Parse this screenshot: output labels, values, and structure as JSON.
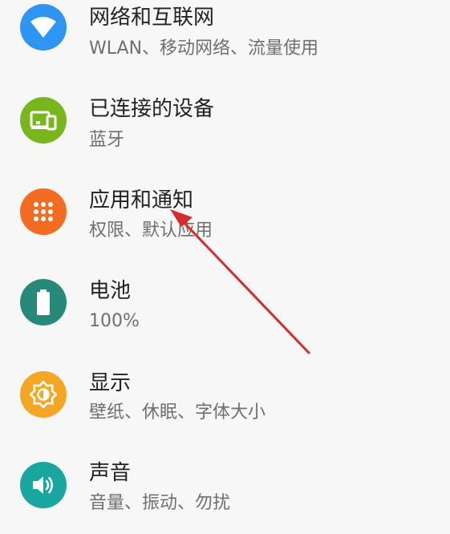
{
  "settings": {
    "items": [
      {
        "id": "network",
        "title": "网络和互联网",
        "subtitle": "WLAN、移动网络、流量使用",
        "icon": "wifi-icon",
        "color": "#2f95f3"
      },
      {
        "id": "connected-devices",
        "title": "已连接的设备",
        "subtitle": "蓝牙",
        "icon": "devices-icon",
        "color": "#78b61d"
      },
      {
        "id": "apps",
        "title": "应用和通知",
        "subtitle": "权限、默认应用",
        "icon": "apps-grid-icon",
        "color": "#f36c21"
      },
      {
        "id": "battery",
        "title": "电池",
        "subtitle": "100%",
        "icon": "battery-icon",
        "color": "#26897a"
      },
      {
        "id": "display",
        "title": "显示",
        "subtitle": "壁纸、休眠、字体大小",
        "icon": "brightness-icon",
        "color": "#f5a623"
      },
      {
        "id": "sound",
        "title": "声音",
        "subtitle": "音量、振动、勿扰",
        "icon": "volume-icon",
        "color": "#1aa6a0"
      }
    ]
  },
  "annotation": {
    "arrow_color": "#d62b2b",
    "points_to": "应用和通知"
  }
}
